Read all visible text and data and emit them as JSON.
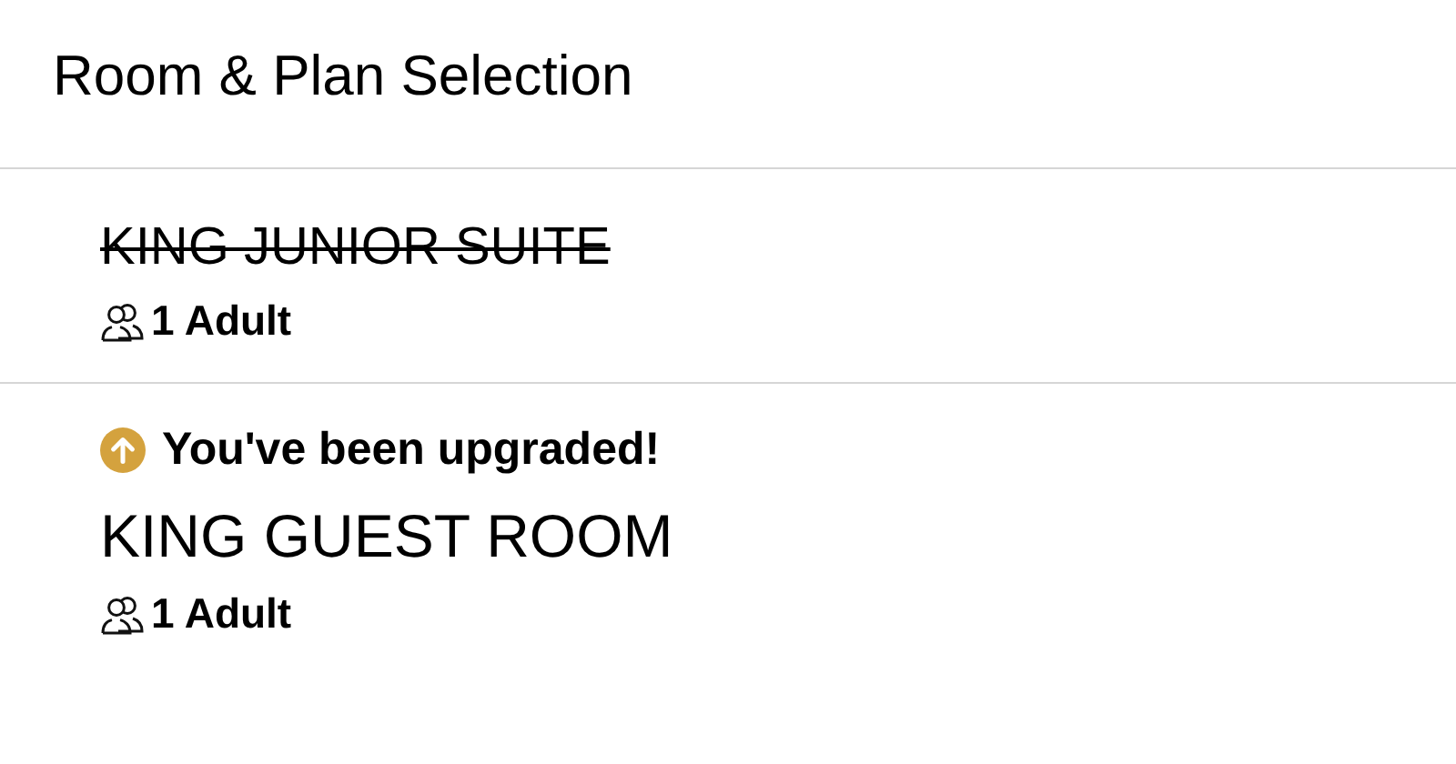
{
  "header": {
    "title": "Room & Plan Selection"
  },
  "rooms": [
    {
      "name": "KING JUNIOR SUITE",
      "struck": true,
      "occupancy": "1 Adult"
    },
    {
      "notice": "You've been upgraded!",
      "name": "KING GUEST ROOM",
      "struck": false,
      "occupancy": "1 Adult"
    }
  ]
}
